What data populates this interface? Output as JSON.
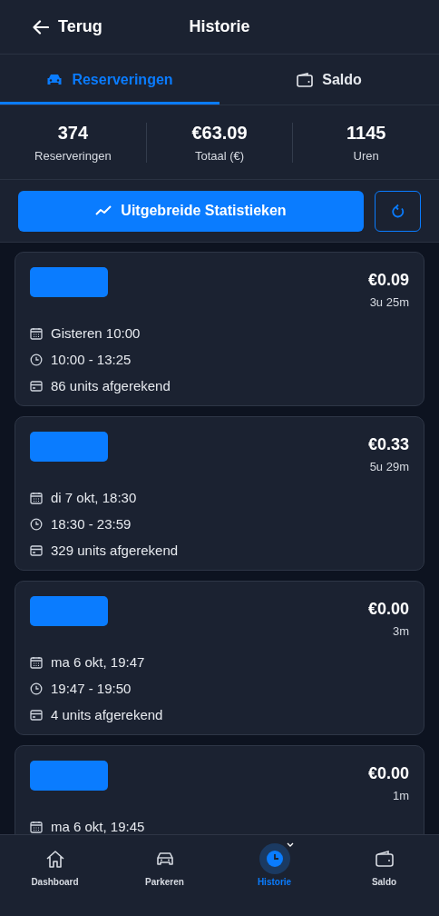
{
  "header": {
    "back": "Terug",
    "title": "Historie"
  },
  "tabs": [
    {
      "label": "Reserveringen",
      "kind": "car",
      "selected": true
    },
    {
      "label": "Saldo",
      "kind": "wallet",
      "selected": false
    }
  ],
  "stats": [
    {
      "value": "374",
      "label": "Reserveringen"
    },
    {
      "value": "€63.09",
      "label": "Totaal (€)"
    },
    {
      "value": "1145",
      "label": "Uren"
    }
  ],
  "stats_button": "Uitgebreide Statistieken",
  "reservations": [
    {
      "amount": "€0.09",
      "duration": "3u 25m",
      "date": "Gisteren 10:00",
      "time": "10:00 - 13:25",
      "units": "86 units afgerekend"
    },
    {
      "amount": "€0.33",
      "duration": "5u 29m",
      "date": "di 7 okt, 18:30",
      "time": "18:30 - 23:59",
      "units": "329 units afgerekend"
    },
    {
      "amount": "€0.00",
      "duration": "3m",
      "date": "ma 6 okt, 19:47",
      "time": "19:47 - 19:50",
      "units": "4 units afgerekend"
    },
    {
      "amount": "€0.00",
      "duration": "1m",
      "date": "ma 6 okt, 19:45"
    }
  ],
  "nav": [
    {
      "label": "Dashboard",
      "kind": "home",
      "selected": false
    },
    {
      "label": "Parkeren",
      "kind": "car",
      "selected": false
    },
    {
      "label": "Historie",
      "kind": "clock",
      "selected": true
    },
    {
      "label": "Saldo",
      "kind": "wallet",
      "selected": false
    }
  ]
}
